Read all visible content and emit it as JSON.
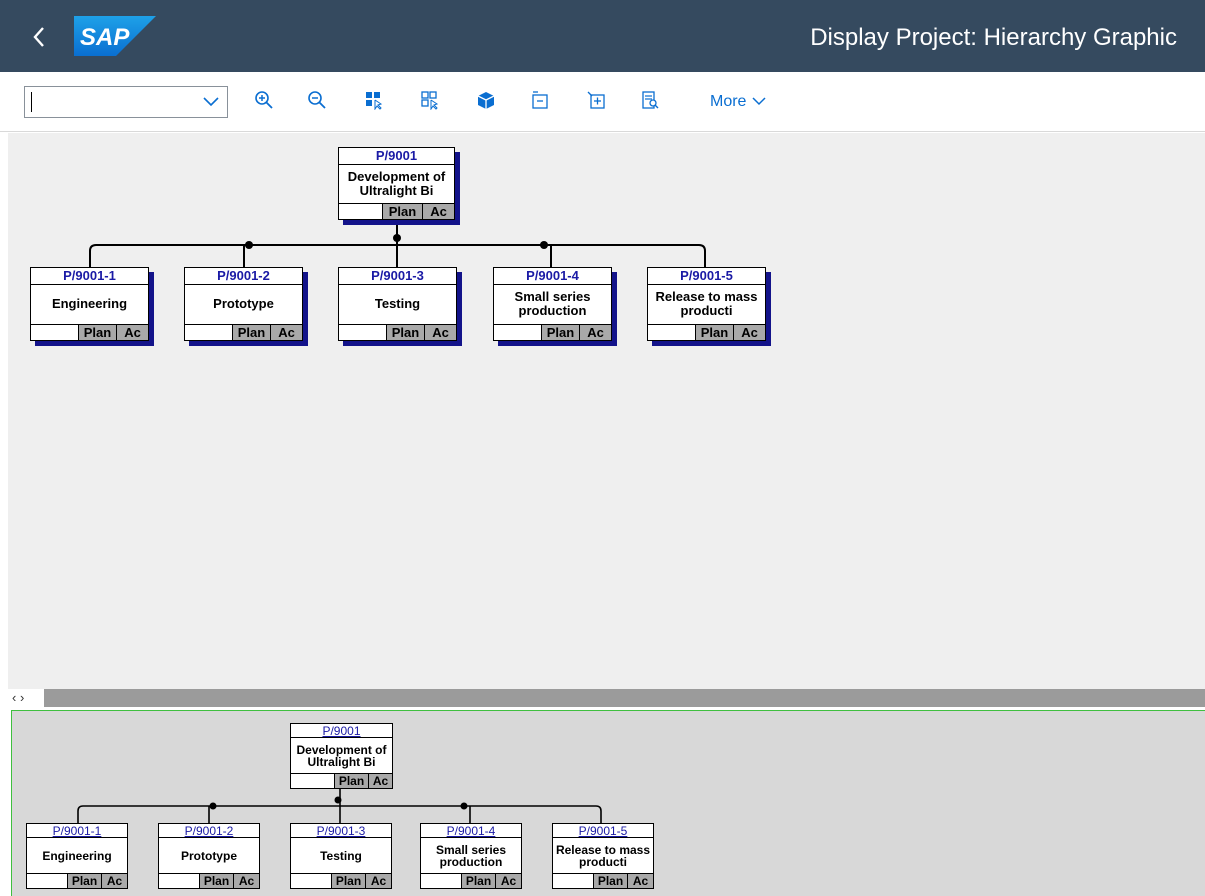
{
  "header": {
    "title": "Display Project: Hierarchy Graphic",
    "logo_text": "SAP",
    "back_icon": "chevron-left-icon"
  },
  "toolbar": {
    "combo_value": "",
    "buttons": [
      {
        "name": "zoom-in-icon"
      },
      {
        "name": "zoom-out-icon"
      },
      {
        "name": "select-all-icon"
      },
      {
        "name": "deselect-all-icon"
      },
      {
        "name": "box-icon"
      },
      {
        "name": "collapse-icon"
      },
      {
        "name": "expand-icon"
      },
      {
        "name": "detail-icon"
      }
    ],
    "more_label": "More"
  },
  "splitter": {
    "arrows": "‹ ›"
  },
  "hierarchy": {
    "root": {
      "id": "P/9001",
      "desc": "Development of Ultralight Bi",
      "plan": "Plan",
      "actual": "Ac"
    },
    "children": [
      {
        "id": "P/9001-1",
        "desc": "Engineering",
        "plan": "Plan",
        "actual": "Ac"
      },
      {
        "id": "P/9001-2",
        "desc": "Prototype",
        "plan": "Plan",
        "actual": "Ac"
      },
      {
        "id": "P/9001-3",
        "desc": "Testing",
        "plan": "Plan",
        "actual": "Ac"
      },
      {
        "id": "P/9001-4",
        "desc": "Small series production",
        "plan": "Plan",
        "actual": "Ac"
      },
      {
        "id": "P/9001-5",
        "desc": "Release to mass producti",
        "plan": "Plan",
        "actual": "Ac"
      }
    ]
  },
  "colors": {
    "shell": "#354a5f",
    "link": "#0a6ed1",
    "node_id": "#1a1aa5",
    "node_shadow": "#13138a",
    "canvas_upper": "#efefef",
    "canvas_lower": "#d8d8d8"
  }
}
